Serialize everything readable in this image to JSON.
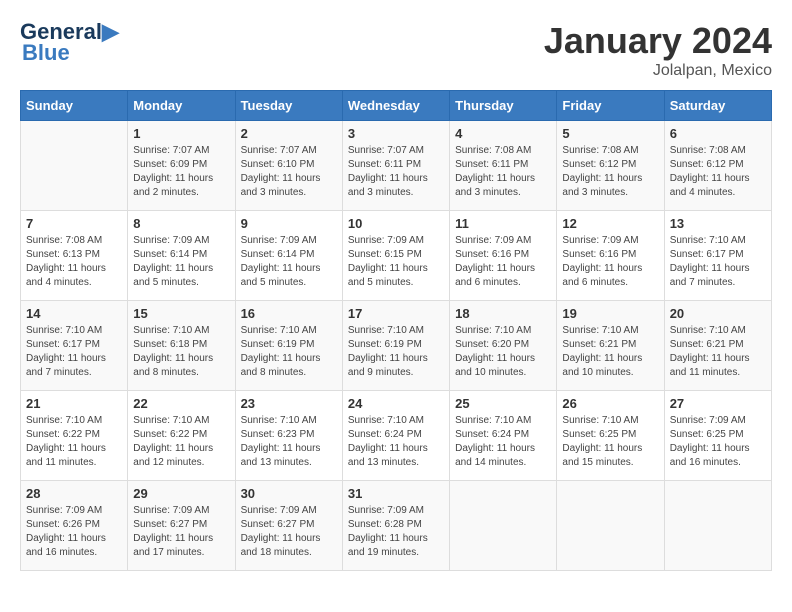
{
  "header": {
    "logo_line1": "General",
    "logo_line2": "Blue",
    "month": "January 2024",
    "location": "Jolalpan, Mexico"
  },
  "weekdays": [
    "Sunday",
    "Monday",
    "Tuesday",
    "Wednesday",
    "Thursday",
    "Friday",
    "Saturday"
  ],
  "weeks": [
    [
      {
        "day": "",
        "sunrise": "",
        "sunset": "",
        "daylight": ""
      },
      {
        "day": "1",
        "sunrise": "7:07 AM",
        "sunset": "6:09 PM",
        "daylight": "11 hours and 2 minutes."
      },
      {
        "day": "2",
        "sunrise": "7:07 AM",
        "sunset": "6:10 PM",
        "daylight": "11 hours and 3 minutes."
      },
      {
        "day": "3",
        "sunrise": "7:07 AM",
        "sunset": "6:11 PM",
        "daylight": "11 hours and 3 minutes."
      },
      {
        "day": "4",
        "sunrise": "7:08 AM",
        "sunset": "6:11 PM",
        "daylight": "11 hours and 3 minutes."
      },
      {
        "day": "5",
        "sunrise": "7:08 AM",
        "sunset": "6:12 PM",
        "daylight": "11 hours and 3 minutes."
      },
      {
        "day": "6",
        "sunrise": "7:08 AM",
        "sunset": "6:12 PM",
        "daylight": "11 hours and 4 minutes."
      }
    ],
    [
      {
        "day": "7",
        "sunrise": "7:08 AM",
        "sunset": "6:13 PM",
        "daylight": "11 hours and 4 minutes."
      },
      {
        "day": "8",
        "sunrise": "7:09 AM",
        "sunset": "6:14 PM",
        "daylight": "11 hours and 5 minutes."
      },
      {
        "day": "9",
        "sunrise": "7:09 AM",
        "sunset": "6:14 PM",
        "daylight": "11 hours and 5 minutes."
      },
      {
        "day": "10",
        "sunrise": "7:09 AM",
        "sunset": "6:15 PM",
        "daylight": "11 hours and 5 minutes."
      },
      {
        "day": "11",
        "sunrise": "7:09 AM",
        "sunset": "6:16 PM",
        "daylight": "11 hours and 6 minutes."
      },
      {
        "day": "12",
        "sunrise": "7:09 AM",
        "sunset": "6:16 PM",
        "daylight": "11 hours and 6 minutes."
      },
      {
        "day": "13",
        "sunrise": "7:10 AM",
        "sunset": "6:17 PM",
        "daylight": "11 hours and 7 minutes."
      }
    ],
    [
      {
        "day": "14",
        "sunrise": "7:10 AM",
        "sunset": "6:17 PM",
        "daylight": "11 hours and 7 minutes."
      },
      {
        "day": "15",
        "sunrise": "7:10 AM",
        "sunset": "6:18 PM",
        "daylight": "11 hours and 8 minutes."
      },
      {
        "day": "16",
        "sunrise": "7:10 AM",
        "sunset": "6:19 PM",
        "daylight": "11 hours and 8 minutes."
      },
      {
        "day": "17",
        "sunrise": "7:10 AM",
        "sunset": "6:19 PM",
        "daylight": "11 hours and 9 minutes."
      },
      {
        "day": "18",
        "sunrise": "7:10 AM",
        "sunset": "6:20 PM",
        "daylight": "11 hours and 10 minutes."
      },
      {
        "day": "19",
        "sunrise": "7:10 AM",
        "sunset": "6:21 PM",
        "daylight": "11 hours and 10 minutes."
      },
      {
        "day": "20",
        "sunrise": "7:10 AM",
        "sunset": "6:21 PM",
        "daylight": "11 hours and 11 minutes."
      }
    ],
    [
      {
        "day": "21",
        "sunrise": "7:10 AM",
        "sunset": "6:22 PM",
        "daylight": "11 hours and 11 minutes."
      },
      {
        "day": "22",
        "sunrise": "7:10 AM",
        "sunset": "6:22 PM",
        "daylight": "11 hours and 12 minutes."
      },
      {
        "day": "23",
        "sunrise": "7:10 AM",
        "sunset": "6:23 PM",
        "daylight": "11 hours and 13 minutes."
      },
      {
        "day": "24",
        "sunrise": "7:10 AM",
        "sunset": "6:24 PM",
        "daylight": "11 hours and 13 minutes."
      },
      {
        "day": "25",
        "sunrise": "7:10 AM",
        "sunset": "6:24 PM",
        "daylight": "11 hours and 14 minutes."
      },
      {
        "day": "26",
        "sunrise": "7:10 AM",
        "sunset": "6:25 PM",
        "daylight": "11 hours and 15 minutes."
      },
      {
        "day": "27",
        "sunrise": "7:09 AM",
        "sunset": "6:25 PM",
        "daylight": "11 hours and 16 minutes."
      }
    ],
    [
      {
        "day": "28",
        "sunrise": "7:09 AM",
        "sunset": "6:26 PM",
        "daylight": "11 hours and 16 minutes."
      },
      {
        "day": "29",
        "sunrise": "7:09 AM",
        "sunset": "6:27 PM",
        "daylight": "11 hours and 17 minutes."
      },
      {
        "day": "30",
        "sunrise": "7:09 AM",
        "sunset": "6:27 PM",
        "daylight": "11 hours and 18 minutes."
      },
      {
        "day": "31",
        "sunrise": "7:09 AM",
        "sunset": "6:28 PM",
        "daylight": "11 hours and 19 minutes."
      },
      {
        "day": "",
        "sunrise": "",
        "sunset": "",
        "daylight": ""
      },
      {
        "day": "",
        "sunrise": "",
        "sunset": "",
        "daylight": ""
      },
      {
        "day": "",
        "sunrise": "",
        "sunset": "",
        "daylight": ""
      }
    ]
  ]
}
